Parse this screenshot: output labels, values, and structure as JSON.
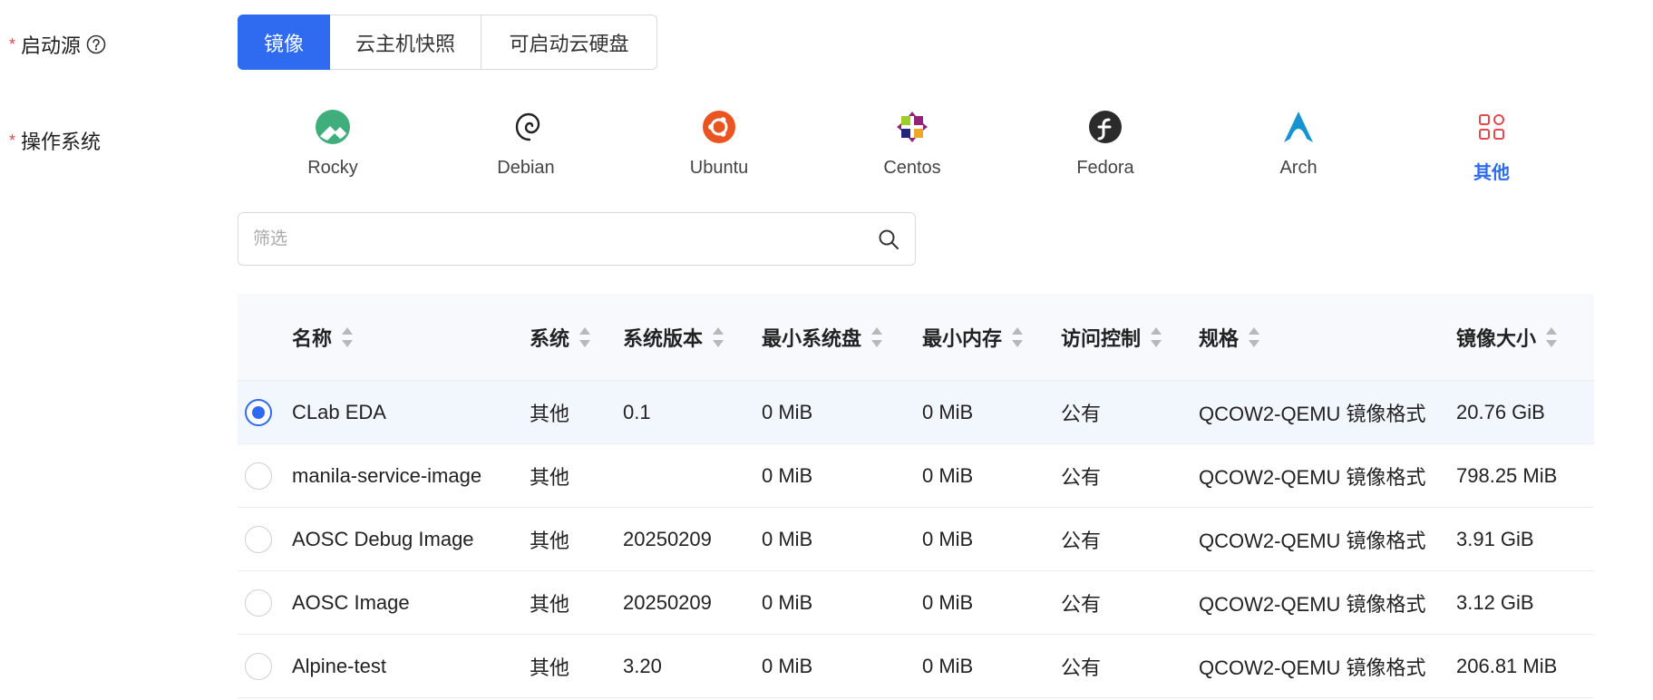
{
  "boot_source": {
    "label": "启动源",
    "required_mark": "*",
    "help_icon": "question-circle-icon",
    "options": [
      {
        "label": "镜像",
        "active": true
      },
      {
        "label": "云主机快照",
        "active": false
      },
      {
        "label": "可启动云硬盘",
        "active": false
      }
    ]
  },
  "os": {
    "label": "操作系统",
    "required_mark": "*",
    "items": [
      {
        "name": "Rocky",
        "icon": "rocky-logo-icon",
        "active": false
      },
      {
        "name": "Debian",
        "icon": "debian-logo-icon",
        "active": false
      },
      {
        "name": "Ubuntu",
        "icon": "ubuntu-logo-icon",
        "active": false
      },
      {
        "name": "Centos",
        "icon": "centos-logo-icon",
        "active": false
      },
      {
        "name": "Fedora",
        "icon": "fedora-logo-icon",
        "active": false
      },
      {
        "name": "Arch",
        "icon": "arch-logo-icon",
        "active": false
      },
      {
        "name": "其他",
        "icon": "apps-grid-icon",
        "active": true
      }
    ]
  },
  "filter": {
    "placeholder": "筛选",
    "value": "",
    "icon": "search-icon"
  },
  "table": {
    "columns": [
      "名称",
      "系统",
      "系统版本",
      "最小系统盘",
      "最小内存",
      "访问控制",
      "规格",
      "镜像大小"
    ],
    "rows": [
      {
        "selected": true,
        "name": "CLab EDA",
        "system": "其他",
        "version": "0.1",
        "min_disk": "0 MiB",
        "min_mem": "0 MiB",
        "access": "公有",
        "format": "QCOW2-QEMU 镜像格式",
        "size": "20.76 GiB"
      },
      {
        "selected": false,
        "name": "manila-service-image",
        "system": "其他",
        "version": "",
        "min_disk": "0 MiB",
        "min_mem": "0 MiB",
        "access": "公有",
        "format": "QCOW2-QEMU 镜像格式",
        "size": "798.25 MiB"
      },
      {
        "selected": false,
        "name": "AOSC Debug Image",
        "system": "其他",
        "version": "20250209",
        "min_disk": "0 MiB",
        "min_mem": "0 MiB",
        "access": "公有",
        "format": "QCOW2-QEMU 镜像格式",
        "size": "3.91 GiB"
      },
      {
        "selected": false,
        "name": "AOSC Image",
        "system": "其他",
        "version": "20250209",
        "min_disk": "0 MiB",
        "min_mem": "0 MiB",
        "access": "公有",
        "format": "QCOW2-QEMU 镜像格式",
        "size": "3.12 GiB"
      },
      {
        "selected": false,
        "name": "Alpine-test",
        "system": "其他",
        "version": "3.20",
        "min_disk": "0 MiB",
        "min_mem": "0 MiB",
        "access": "公有",
        "format": "QCOW2-QEMU 镜像格式",
        "size": "206.81 MiB"
      }
    ]
  },
  "colors": {
    "accent": "#2f6bf0",
    "required": "#e5484d",
    "header_bg": "#f7f9fc",
    "selected_row_bg": "#f2f6fd"
  }
}
